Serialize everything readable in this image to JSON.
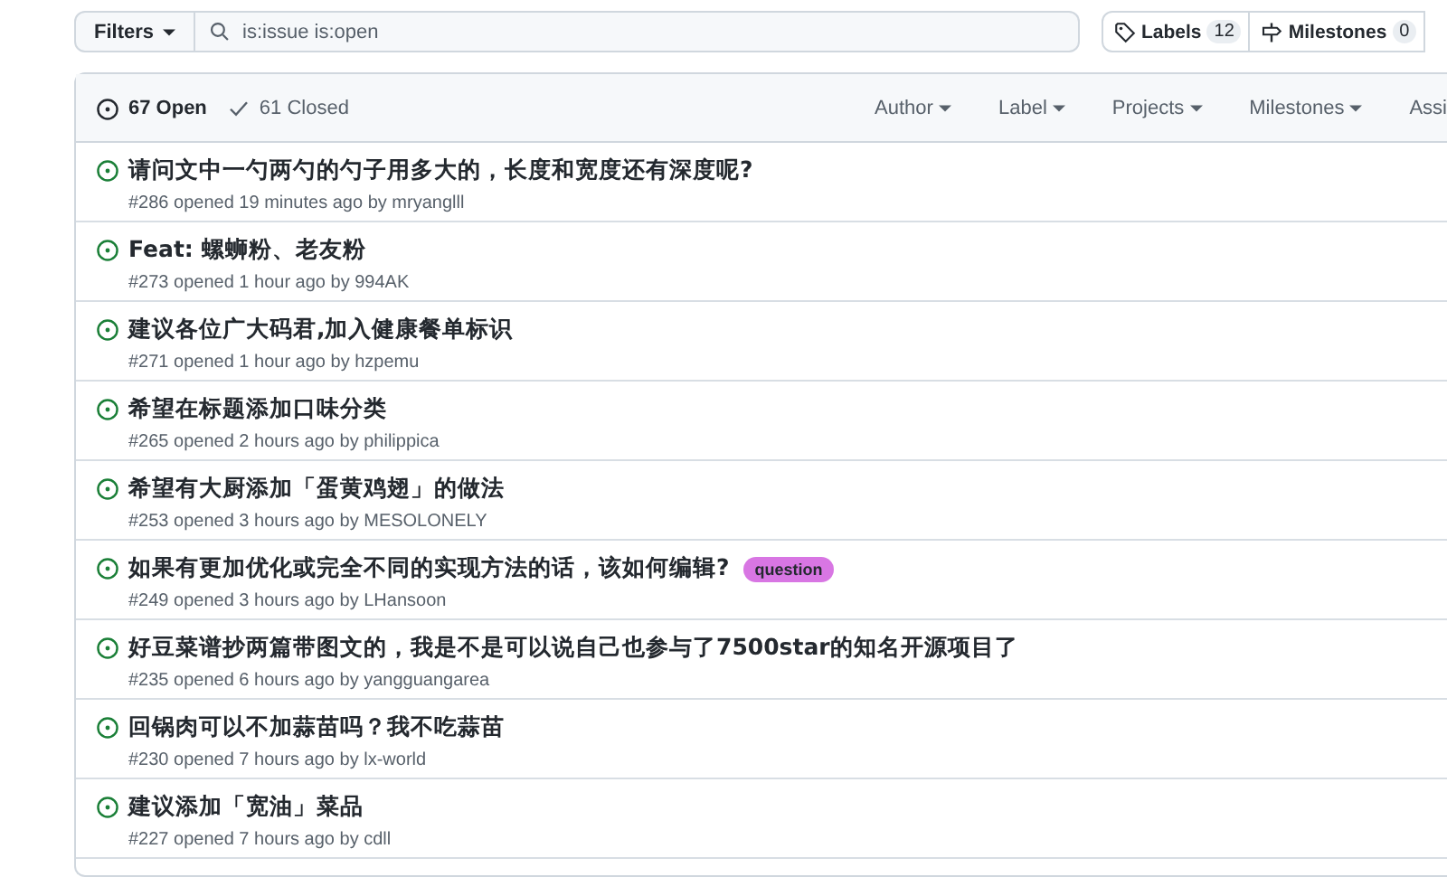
{
  "search": {
    "filter_button": "Filters",
    "value": "is:issue is:open"
  },
  "nav_buttons": [
    {
      "kind": "labels",
      "label": "Labels",
      "count": "12"
    },
    {
      "kind": "milestones",
      "label": "Milestones",
      "count": "0"
    }
  ],
  "states": [
    {
      "kind": "open",
      "label": "67 Open",
      "selected": true
    },
    {
      "kind": "closed",
      "label": "61 Closed",
      "selected": false
    }
  ],
  "filters": [
    "Author",
    "Label",
    "Projects",
    "Milestones",
    "Assi"
  ],
  "issues": [
    {
      "title": "请问文中一勺两勺的勺子用多大的，长度和宽度还有深度呢?",
      "meta": "#286 opened 19 minutes ago by mryanglll"
    },
    {
      "title": "Feat: 螺蛳粉、老友粉",
      "meta": "#273 opened 1 hour ago by 994AK"
    },
    {
      "title": "建议各位广大码君,加入健康餐单标识",
      "meta": "#271 opened 1 hour ago by hzpemu"
    },
    {
      "title": "希望在标题添加口味分类",
      "meta": "#265 opened 2 hours ago by philippica"
    },
    {
      "title": "希望有大厨添加「蛋黄鸡翅」的做法",
      "meta": "#253 opened 3 hours ago by MESOLONELY"
    },
    {
      "title": "如果有更加优化或完全不同的实现方法的话，该如何编辑?",
      "meta": "#249 opened 3 hours ago by LHansoon",
      "labels": [
        {
          "name": "question",
          "color": "#d876e3"
        }
      ]
    },
    {
      "title": "好豆菜谱抄两篇带图文的，我是不是可以说自己也参与了7500star的知名开源项目了",
      "meta": "#235 opened 6 hours ago by yangguangarea"
    },
    {
      "title": "回锅肉可以不加蒜苗吗？我不吃蒜苗",
      "meta": "#230 opened 7 hours ago by lx-world"
    },
    {
      "title": "建议添加「宽油」菜品",
      "meta": "#227 opened 7 hours ago by cdll"
    }
  ]
}
